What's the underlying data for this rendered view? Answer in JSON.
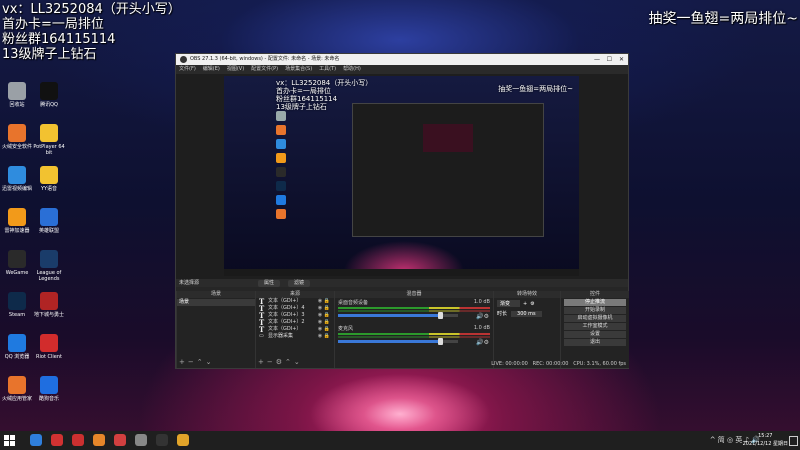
{
  "overlay": {
    "top_left_lines": [
      "vx：LL3252084（开头小写）",
      "首办卡=一局排位",
      "粉丝群164115114",
      "13级牌子上钻石"
    ],
    "top_right": "抽奖一鱼翅=两局排位~"
  },
  "desktop_icons": [
    {
      "label": "回收站",
      "color": "#9aa0a6"
    },
    {
      "label": "腾讯QQ",
      "color": "#111111"
    },
    {
      "label": "火绒安全软件",
      "color": "#e8742c"
    },
    {
      "label": "PotPlayer 64 bit",
      "color": "#f2c230"
    },
    {
      "label": "迅雷视频编辑",
      "color": "#2f8cde"
    },
    {
      "label": "YY语音",
      "color": "#f2c230"
    },
    {
      "label": "雷神加速器",
      "color": "#f29a1a"
    },
    {
      "label": "英雄联盟",
      "color": "#2a6fd6"
    },
    {
      "label": "WeGame",
      "color": "#2a2a2a"
    },
    {
      "label": "League of Legends",
      "color": "#1a3c6a"
    },
    {
      "label": "Steam",
      "color": "#0e2a4a"
    },
    {
      "label": "地下城与勇士",
      "color": "#b02424"
    },
    {
      "label": "QQ 浏览器",
      "color": "#1f7ae0"
    },
    {
      "label": "Riot Client",
      "color": "#d22c2c"
    },
    {
      "label": "火绒应用管家",
      "color": "#e8742c"
    },
    {
      "label": "酷狗音乐",
      "color": "#1f6ee0"
    }
  ],
  "obs": {
    "title": "OBS 27.1.3 (64-bit, windows) - 配置文件: 未命名 - 场景: 未命名",
    "menu": [
      "文件(F)",
      "编辑(E)",
      "视图(V)",
      "配置文件(P)",
      "场景集合(S)",
      "工具(T)",
      "帮助(H)"
    ],
    "preview_overlay_left": [
      "vx：LL3252084（开头小写）",
      "首办卡=一局排位",
      "粉丝群164115114",
      "13级牌子上钻石"
    ],
    "preview_overlay_right": "抽奖一鱼翅=两局排位~",
    "selection_bar": {
      "label": "未选择源",
      "props_button": "属性",
      "filters_button": "滤镜"
    },
    "scenes": {
      "header": "场景",
      "items": [
        "场景"
      ]
    },
    "sources": {
      "header": "来源",
      "items": [
        "文本（GDI+）",
        "文本（GDI+）4",
        "文本（GDI+）3",
        "文本（GDI+）2",
        "文本（GDI+）",
        "显示器采集"
      ]
    },
    "mixer": {
      "header": "混音器",
      "channels": [
        {
          "name": "桌面音频设备",
          "db": "1.0 dB",
          "level": 0.85
        },
        {
          "name": "麦克风",
          "db": "1.0 dB",
          "level": 0.85
        }
      ]
    },
    "transitions": {
      "header": "转场特效",
      "type": "渐变",
      "duration_label": "时长",
      "duration": "300 ms"
    },
    "controls": {
      "header": "控件",
      "buttons": [
        "停止推流",
        "开始录制",
        "启动虚拟摄像机",
        "工作室模式",
        "设置",
        "退出"
      ]
    },
    "status": {
      "live": "LIVE: 00:00:00",
      "rec": "REC: 00:00:00",
      "cpu": "CPU: 3.1%, 60.00 fps"
    }
  },
  "taskbar": {
    "apps": [
      {
        "name": "edge",
        "color": "#2f7fdc"
      },
      {
        "name": "netease",
        "color": "#d23232"
      },
      {
        "name": "obs",
        "color": "#cc3030"
      },
      {
        "name": "douyu",
        "color": "#e6862a"
      },
      {
        "name": "app5",
        "color": "#d24040"
      },
      {
        "name": "app6",
        "color": "#888888"
      },
      {
        "name": "app7",
        "color": "#333333"
      },
      {
        "name": "app8",
        "color": "#e2a42a"
      }
    ],
    "tray_text": "^ 简 ◎ 英 ♪ 🔊",
    "time": "15:27",
    "date": "2021/12/12 星期日"
  }
}
